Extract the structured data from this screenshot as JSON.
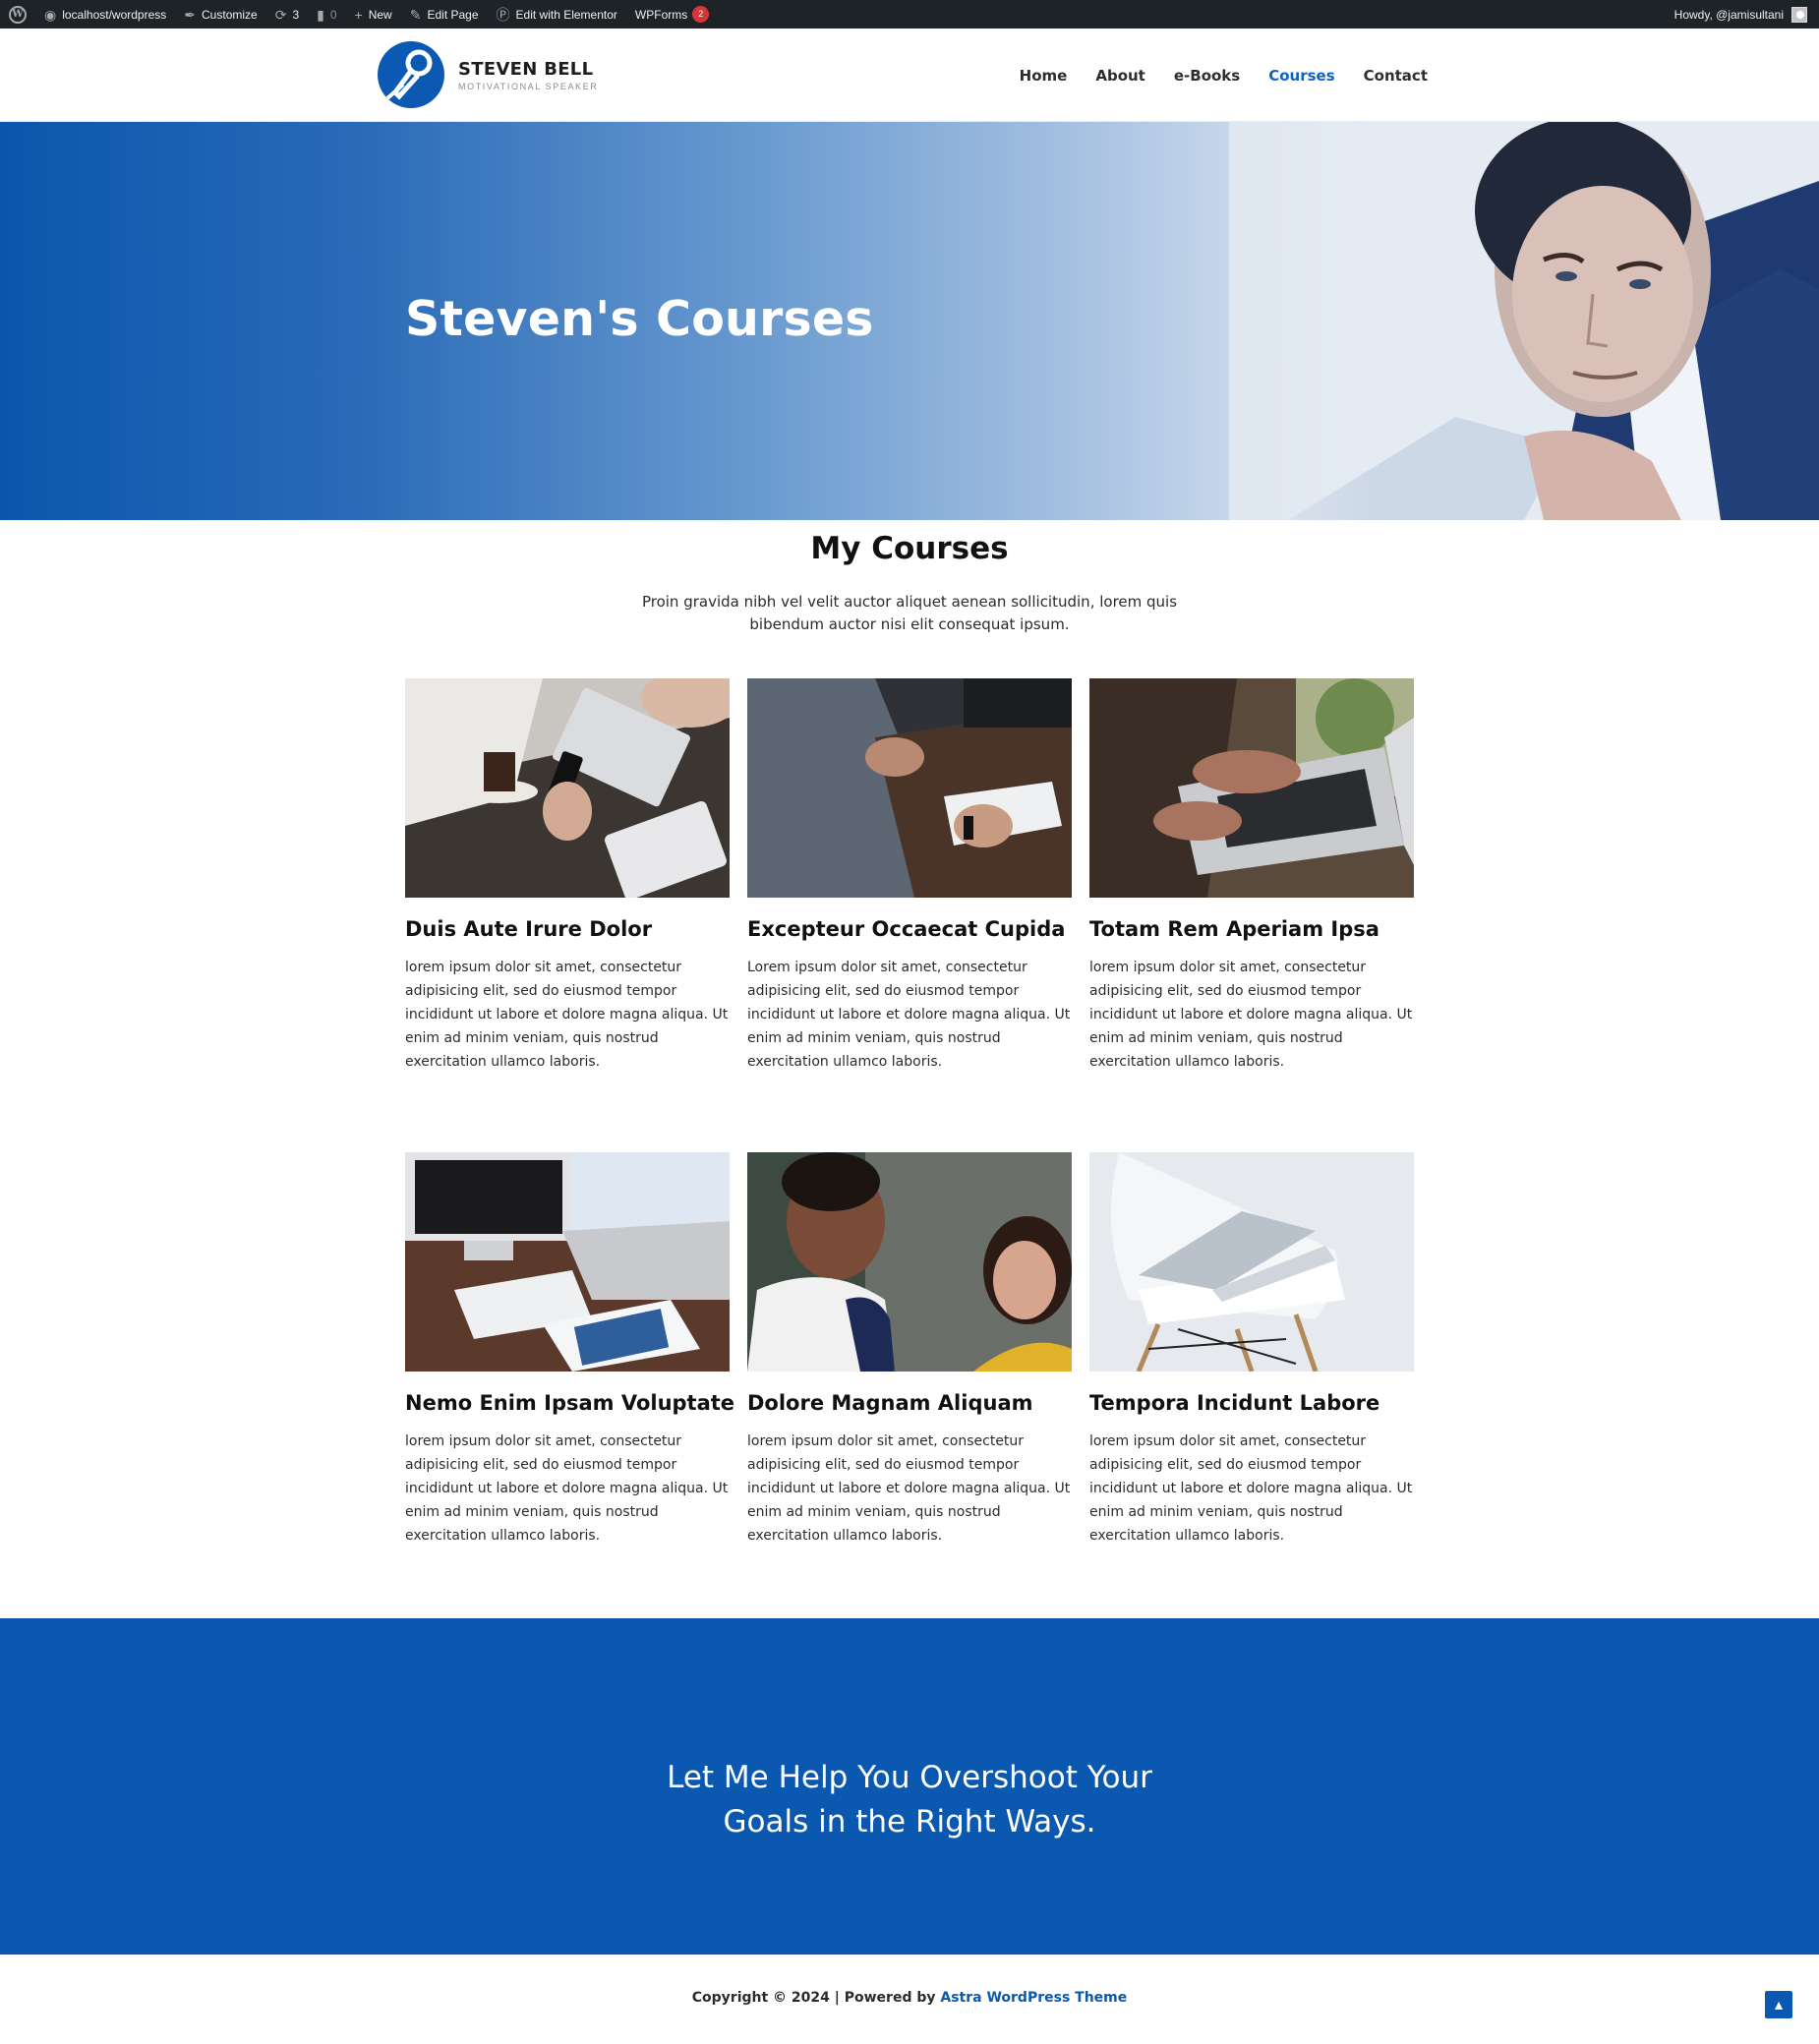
{
  "admin_bar": {
    "site": "localhost/wordpress",
    "customize": "Customize",
    "updates": "3",
    "comments": "0",
    "new": "New",
    "edit_page": "Edit Page",
    "elementor": "Edit with Elementor",
    "wpforms": "WPForms",
    "wpforms_badge": "2",
    "howdy": "Howdy, @jamisultani"
  },
  "header": {
    "logo_name": "STEVEN BELL",
    "logo_tagline": "MOTIVATIONAL SPEAKER",
    "nav": [
      "Home",
      "About",
      "e-Books",
      "Courses",
      "Contact"
    ],
    "active_nav": "Courses"
  },
  "hero": {
    "title": "Steven's Courses"
  },
  "courses": {
    "title": "My Courses",
    "subtitle": "Proin gravida nibh vel velit auctor aliquet aenean sollicitudin, lorem quis bibendum auctor nisi elit consequat ipsum.",
    "cards": [
      {
        "title": "Duis Aute Irure Dolor",
        "text": "lorem ipsum dolor sit amet, consectetur adipisicing elit, sed do eiusmod tempor incididunt ut labore et dolore magna aliqua. Ut enim ad minim veniam, quis nostrud exercitation ullamco laboris."
      },
      {
        "title": "Excepteur Occaecat Cupida",
        "text": "Lorem ipsum dolor sit amet, consectetur adipisicing elit, sed do eiusmod tempor incididunt ut labore et dolore magna aliqua. Ut enim ad minim veniam, quis nostrud exercitation ullamco laboris."
      },
      {
        "title": "Totam Rem Aperiam Ipsa",
        "text": "lorem ipsum dolor sit amet, consectetur adipisicing elit, sed do eiusmod tempor incididunt ut labore et dolore magna aliqua. Ut enim ad minim veniam, quis nostrud exercitation ullamco laboris."
      },
      {
        "title": "Nemo Enim Ipsam Voluptate",
        "text": "lorem ipsum dolor sit amet, consectetur adipisicing elit, sed do eiusmod tempor incididunt ut labore et dolore magna aliqua. Ut enim ad minim veniam, quis nostrud exercitation ullamco laboris."
      },
      {
        "title": "Dolore Magnam Aliquam",
        "text": "lorem ipsum dolor sit amet, consectetur adipisicing elit, sed do eiusmod tempor incididunt ut labore et dolore magna aliqua. Ut enim ad minim veniam, quis nostrud exercitation ullamco laboris."
      },
      {
        "title": "Tempora Incidunt Labore",
        "text": "lorem ipsum dolor sit amet, consectetur adipisicing elit, sed do eiusmod tempor incididunt ut labore et dolore magna aliqua. Ut enim ad minim veniam, quis nostrud exercitation ullamco laboris."
      }
    ]
  },
  "cta": {
    "title": "Let Me Help You Overshoot Your Goals in the Right Ways."
  },
  "footer": {
    "copyright": "Copyright © 2024 | Powered by ",
    "theme_link": "Astra WordPress Theme"
  },
  "colors": {
    "brand_blue": "#0b58b0",
    "active_nav": "#0b66c3",
    "admin_bar": "#1d2327"
  }
}
